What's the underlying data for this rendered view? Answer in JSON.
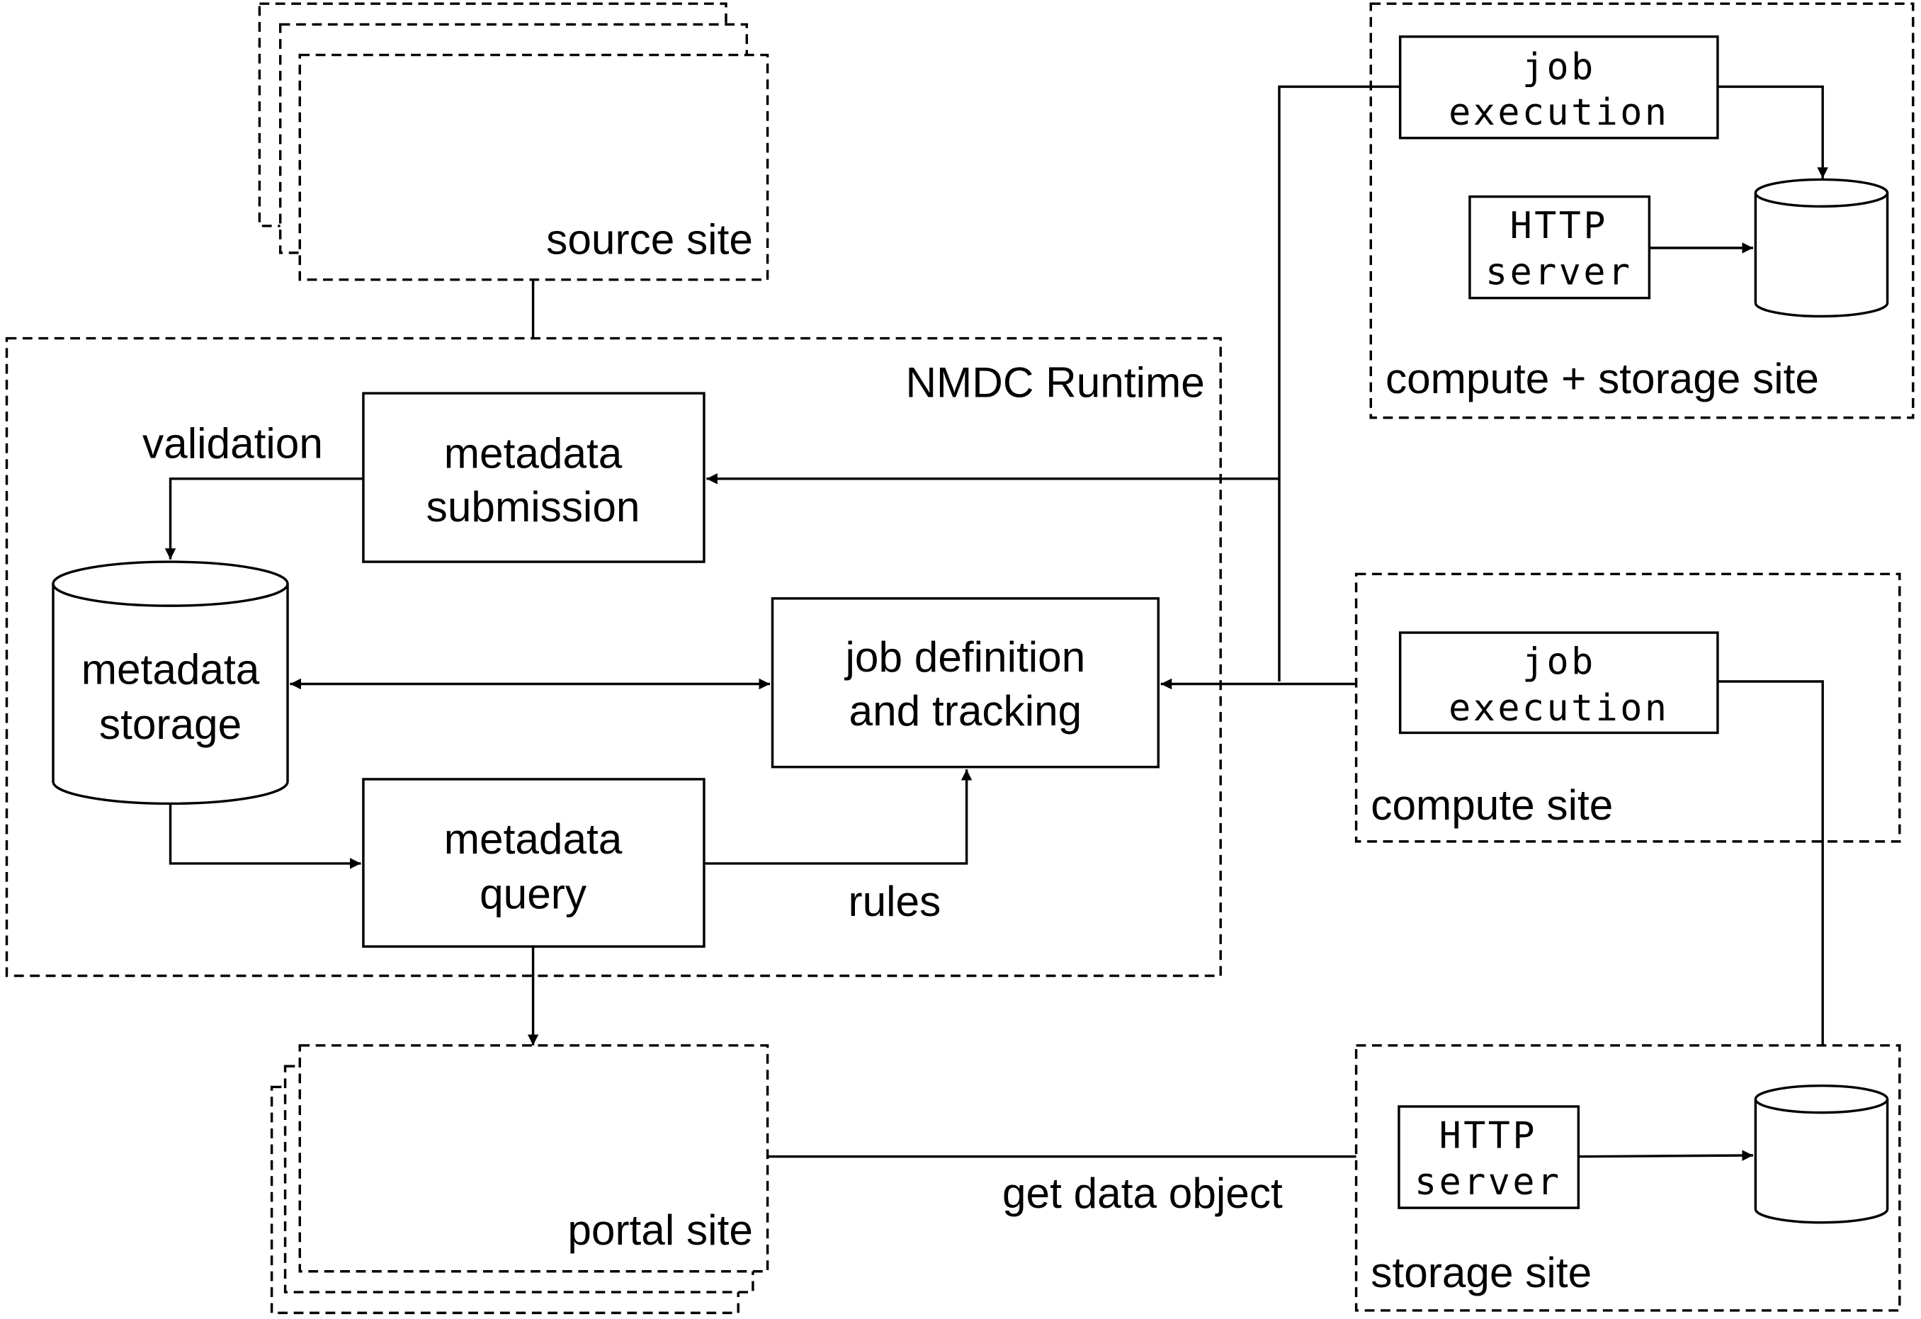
{
  "source_site": {
    "label": "source site"
  },
  "runtime": {
    "label": "NMDC Runtime"
  },
  "metadata_submission": {
    "line1": "metadata",
    "line2": "submission"
  },
  "validation": {
    "label": "validation"
  },
  "metadata_storage": {
    "line1": "metadata",
    "line2": "storage"
  },
  "job_definition": {
    "line1": "job definition",
    "line2": "and tracking"
  },
  "metadata_query": {
    "line1": "metadata",
    "line2": "query"
  },
  "rules": {
    "label": "rules"
  },
  "portal_site": {
    "label": "portal site"
  },
  "get_data_object": {
    "label": "get data object"
  },
  "compute_storage_site": {
    "label": "compute + storage site",
    "job_line1": "job",
    "job_line2": "execution",
    "http_line1": "HTTP",
    "http_line2": "server"
  },
  "compute_site": {
    "label": "compute site",
    "job_line1": "job",
    "job_line2": "execution"
  },
  "storage_site": {
    "label": "storage site",
    "http_line1": "HTTP",
    "http_line2": "server"
  }
}
